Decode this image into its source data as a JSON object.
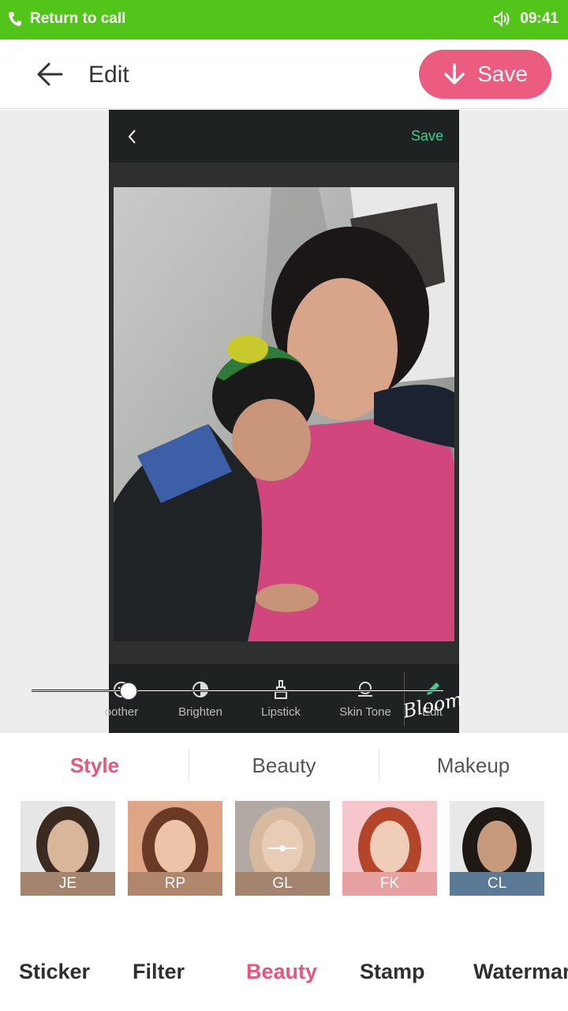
{
  "status": {
    "call_text": "Return to call",
    "time": "09:41",
    "icons": [
      "phone-icon",
      "speaker-icon"
    ]
  },
  "header": {
    "title": "Edit",
    "save_label": "Save",
    "back_icon": "back-arrow-icon",
    "save_icon": "download-arrow-icon"
  },
  "editor": {
    "save_label": "Save",
    "back_icon": "chevron-left-icon",
    "tools": [
      {
        "label": "oother",
        "icon": "smoother-icon"
      },
      {
        "label": "Brighten",
        "icon": "brighten-icon"
      },
      {
        "label": "Lipstick",
        "icon": "lipstick-icon"
      },
      {
        "label": "Skin Tone",
        "icon": "skin-tone-icon"
      },
      {
        "label": "Edit",
        "icon": "edit-icon"
      }
    ],
    "watermark": "Bloom",
    "slider_value": 0.25
  },
  "tabs": [
    {
      "label": "Style",
      "active": true
    },
    {
      "label": "Beauty",
      "active": false
    },
    {
      "label": "Makeup",
      "active": false
    }
  ],
  "styles": [
    {
      "label": "JE",
      "color": "#a4846f"
    },
    {
      "label": "RP",
      "color": "#b0876c"
    },
    {
      "label": "GL",
      "color": "#a4846f"
    },
    {
      "label": "FK",
      "color": "#e8a1a1"
    },
    {
      "label": "CL",
      "color": "#5a7a95"
    }
  ],
  "bottom_nav": [
    {
      "label": "Sticker",
      "active": false
    },
    {
      "label": "Filter",
      "active": false
    },
    {
      "label": "Beauty",
      "active": true
    },
    {
      "label": "Stamp",
      "active": false
    },
    {
      "label": "Watermar",
      "active": false
    }
  ],
  "colors": {
    "status_bar": "#52c41a",
    "accent": "#ec5b80",
    "editor_save": "#3ecf8e"
  }
}
